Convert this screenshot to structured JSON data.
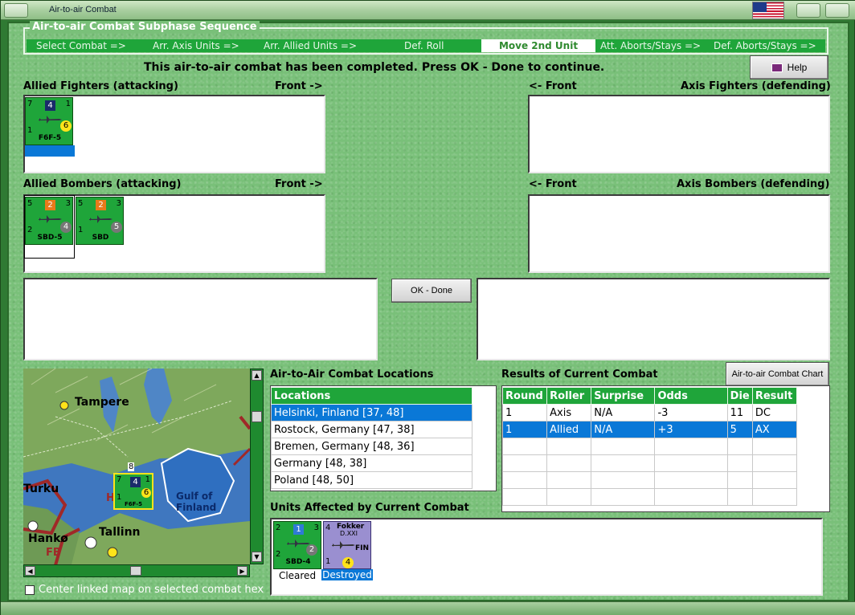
{
  "window": {
    "title": "Air-to-air Combat"
  },
  "subphase": {
    "legend": "Air-to-air Combat Subphase Sequence",
    "steps": [
      "Select Combat =>",
      "Arr. Axis Units =>",
      "Arr. Allied Units =>",
      "Def. Roll",
      "Move 2nd Unit",
      "Att. Aborts/Stays =>",
      "Def. Aborts/Stays =>"
    ],
    "active_index": 4
  },
  "status_message": "This air-to-air combat has been completed.  Press OK - Done to continue.",
  "help_label": "Help",
  "allied_fighters": {
    "label": "Allied Fighters (attacking)",
    "front": "Front ->"
  },
  "axis_fighters": {
    "label": "Axis Fighters (defending)",
    "front": "<- Front"
  },
  "allied_bombers": {
    "label": "Allied Bombers (attacking)",
    "front": "Front ->"
  },
  "axis_bombers": {
    "label": "Axis Bombers (defending)",
    "front": "<- Front"
  },
  "ok_done_label": "OK - Done",
  "counters": {
    "f6f": {
      "tl": "7",
      "box": "4",
      "tr": "1",
      "bl": "1",
      "dot": "6",
      "code": "F6F-5"
    },
    "sbd5": {
      "tl": "5",
      "box": "2",
      "tr": "3",
      "bl": "2",
      "dot": "4",
      "code": "SBD-5"
    },
    "sbd": {
      "tl": "5",
      "box": "2",
      "tr": "3",
      "bl": "1",
      "dot": "5",
      "code": "SBD"
    },
    "sbd4": {
      "tl": "2",
      "box": "1",
      "tr": "3",
      "bl": "2",
      "dot": "2",
      "code": "SBD-4"
    },
    "fokker": {
      "name": "Fokker",
      "model": "D.XXI",
      "tl": "4",
      "fin": "FIN",
      "bl": "1",
      "dot": "4"
    },
    "map_unit": {
      "top": "8",
      "tl": "7",
      "box": "4",
      "tr": "1",
      "bl": "1",
      "dot": "6",
      "code": "F6F-5"
    }
  },
  "map": {
    "labels": [
      "Tampere",
      "Turku",
      "Gulf of Finland",
      "Hankø",
      "FB",
      "Tallinn",
      "H"
    ]
  },
  "locations": {
    "title": "Air-to-Air Combat Locations",
    "header": "Locations",
    "rows": [
      "Helsinki, Finland [37, 48]",
      "Rostock, Germany [47, 38]",
      "Bremen, Germany [48, 36]",
      "Germany [48, 38]",
      "Poland [48, 50]"
    ],
    "selected_index": 0
  },
  "results": {
    "title": "Results of Current Combat",
    "chart_button": "Air-to-air Combat Chart",
    "columns": [
      "Round",
      "Roller",
      "Surprise",
      "Odds",
      "Die",
      "Result"
    ],
    "rows": [
      [
        "1",
        "Axis",
        "N/A",
        "-3",
        "11",
        "DC"
      ],
      [
        "1",
        "Allied",
        "N/A",
        "+3",
        "5",
        "AX"
      ]
    ],
    "selected_index": 1
  },
  "affected": {
    "title": "Units Affected by Current Combat",
    "captions": [
      "Cleared",
      "Destroyed"
    ]
  },
  "center_map_label": "Center linked map on selected combat hex",
  "colors": {
    "felt": "#79c079",
    "accent": "#1fa53a",
    "selection": "#0a78d7"
  }
}
